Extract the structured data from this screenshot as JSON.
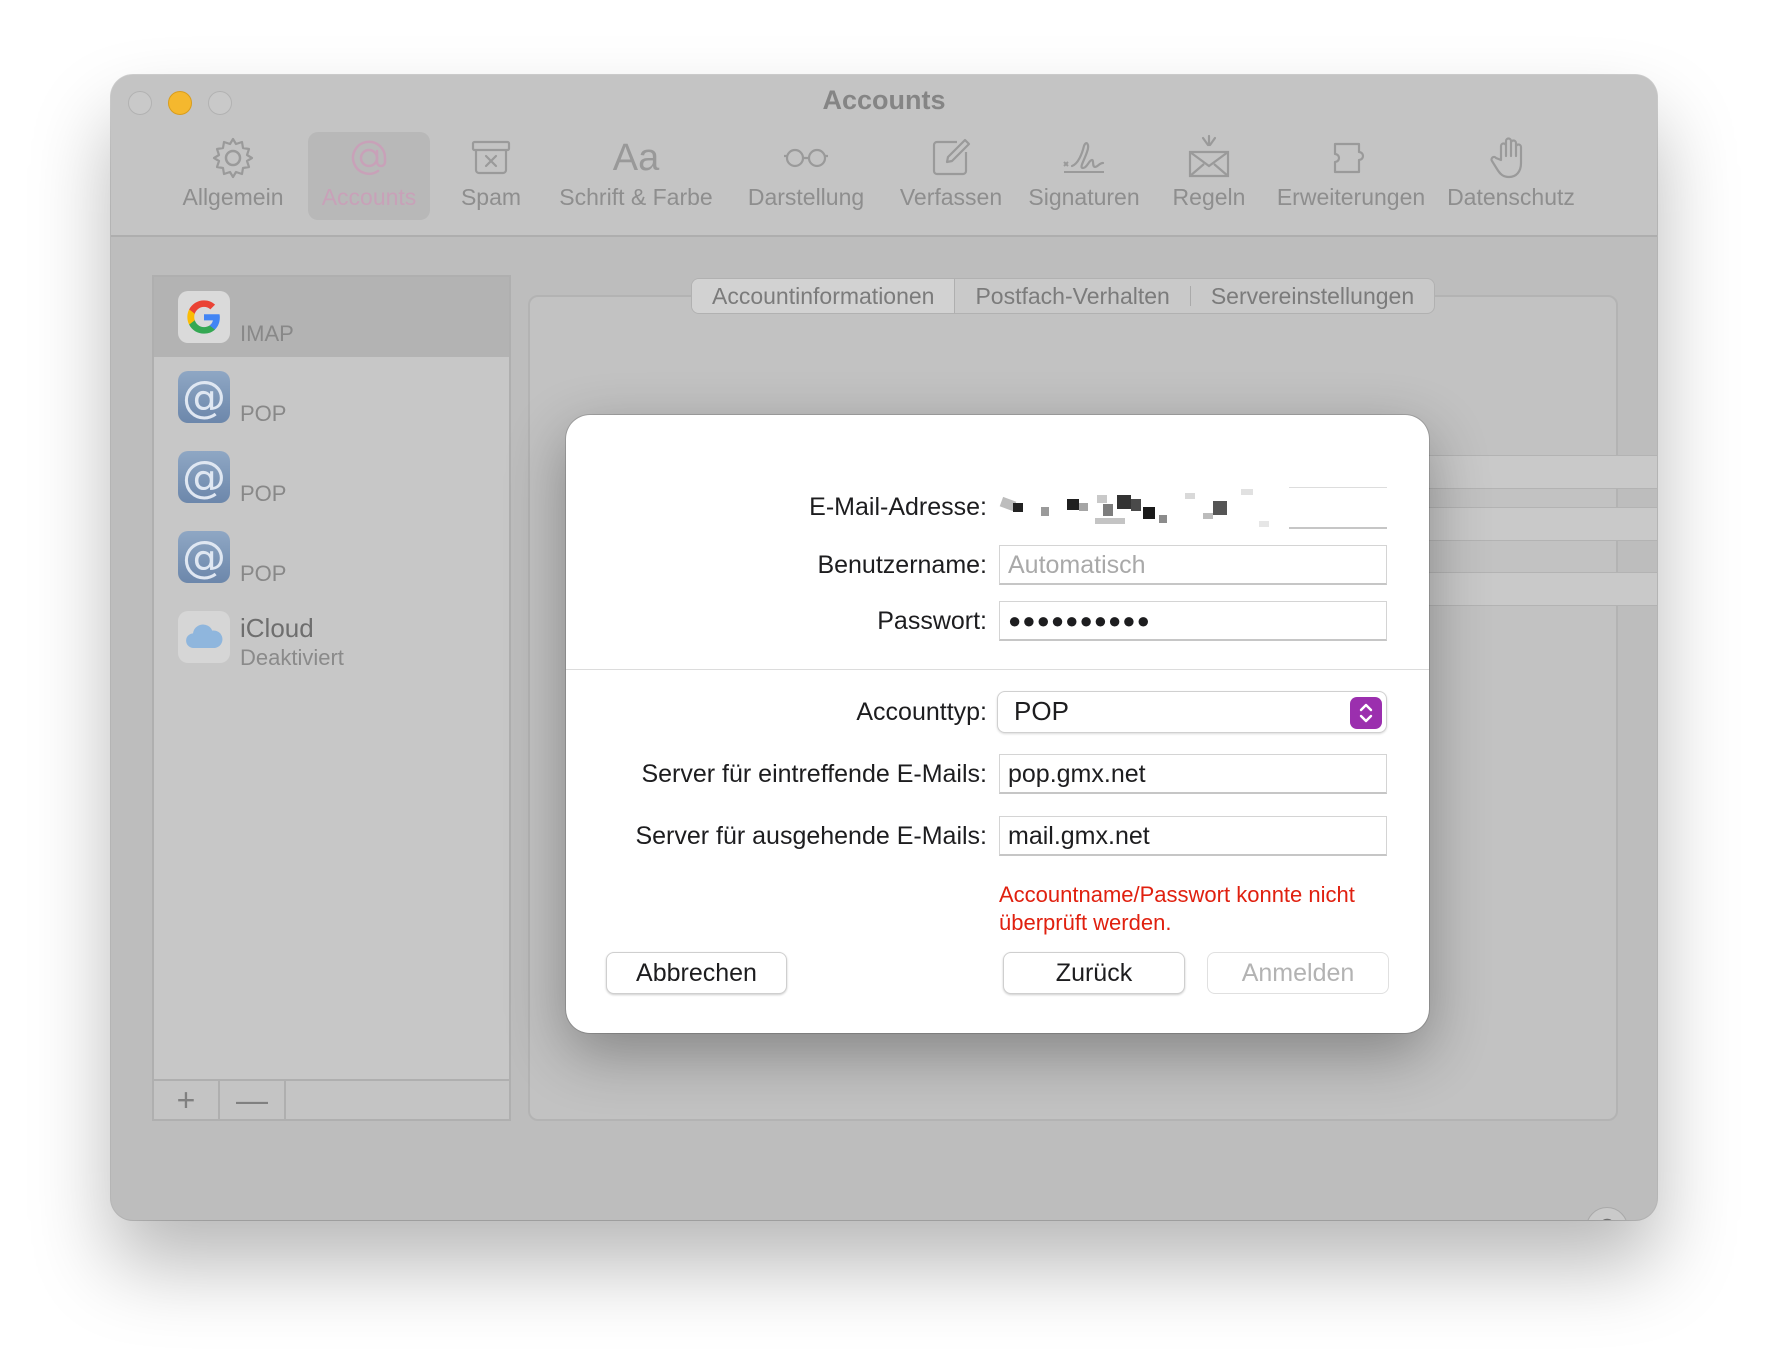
{
  "window": {
    "title": "Accounts"
  },
  "toolbar": {
    "items": [
      {
        "label": "Allgemein",
        "icon": "gear-icon"
      },
      {
        "label": "Accounts",
        "icon": "at-icon"
      },
      {
        "label": "Spam",
        "icon": "junk-tray-icon"
      },
      {
        "label": "Schrift & Farbe",
        "icon": "font-aa-icon",
        "glyph": "Aa"
      },
      {
        "label": "Darstellung",
        "icon": "glasses-icon"
      },
      {
        "label": "Verfassen",
        "icon": "compose-icon"
      },
      {
        "label": "Signaturen",
        "icon": "signature-icon"
      },
      {
        "label": "Regeln",
        "icon": "rules-envelope-icon"
      },
      {
        "label": "Erweiterungen",
        "icon": "puzzle-icon"
      },
      {
        "label": "Datenschutz",
        "icon": "hand-icon"
      }
    ],
    "active_index": 1
  },
  "sidebar": {
    "accounts": [
      {
        "type": "IMAP",
        "icon": "google-icon"
      },
      {
        "type": "POP",
        "icon": "at-sign-icon",
        "glyph": "@"
      },
      {
        "type": "POP",
        "icon": "at-sign-icon",
        "glyph": "@"
      },
      {
        "type": "POP",
        "icon": "at-sign-icon",
        "glyph": "@"
      },
      {
        "name": "iCloud",
        "status": "Deaktiviert",
        "icon": "icloud-icon"
      }
    ],
    "add_glyph": "+",
    "remove_glyph": "—"
  },
  "tabs": {
    "items": [
      "Accountinformationen",
      "Postfach-Verhalten",
      "Servereinstellungen"
    ],
    "active_index": 0
  },
  "help_glyph": "?",
  "dialog": {
    "email_label": "E-Mail-Adresse:",
    "email_value": "",
    "username_label": "Benutzername:",
    "username_placeholder": "Automatisch",
    "password_label": "Passwort:",
    "password_value": "●●●●●●●●●●",
    "account_type_label": "Accounttyp:",
    "account_type_value": "POP",
    "incoming_label": "Server für eintreffende E-Mails:",
    "incoming_value": "pop.gmx.net",
    "outgoing_label": "Server für ausgehende E-Mails:",
    "outgoing_value": "mail.gmx.net",
    "error": "Accountname/Passwort konnte nicht überprüft werden.",
    "cancel_label": "Abbrechen",
    "back_label": "Zurück",
    "signin_label": "Anmelden"
  },
  "colors": {
    "traffic_minimize": "#f5b82e",
    "select_accent": "#9b2fae",
    "error": "#e0200f"
  }
}
